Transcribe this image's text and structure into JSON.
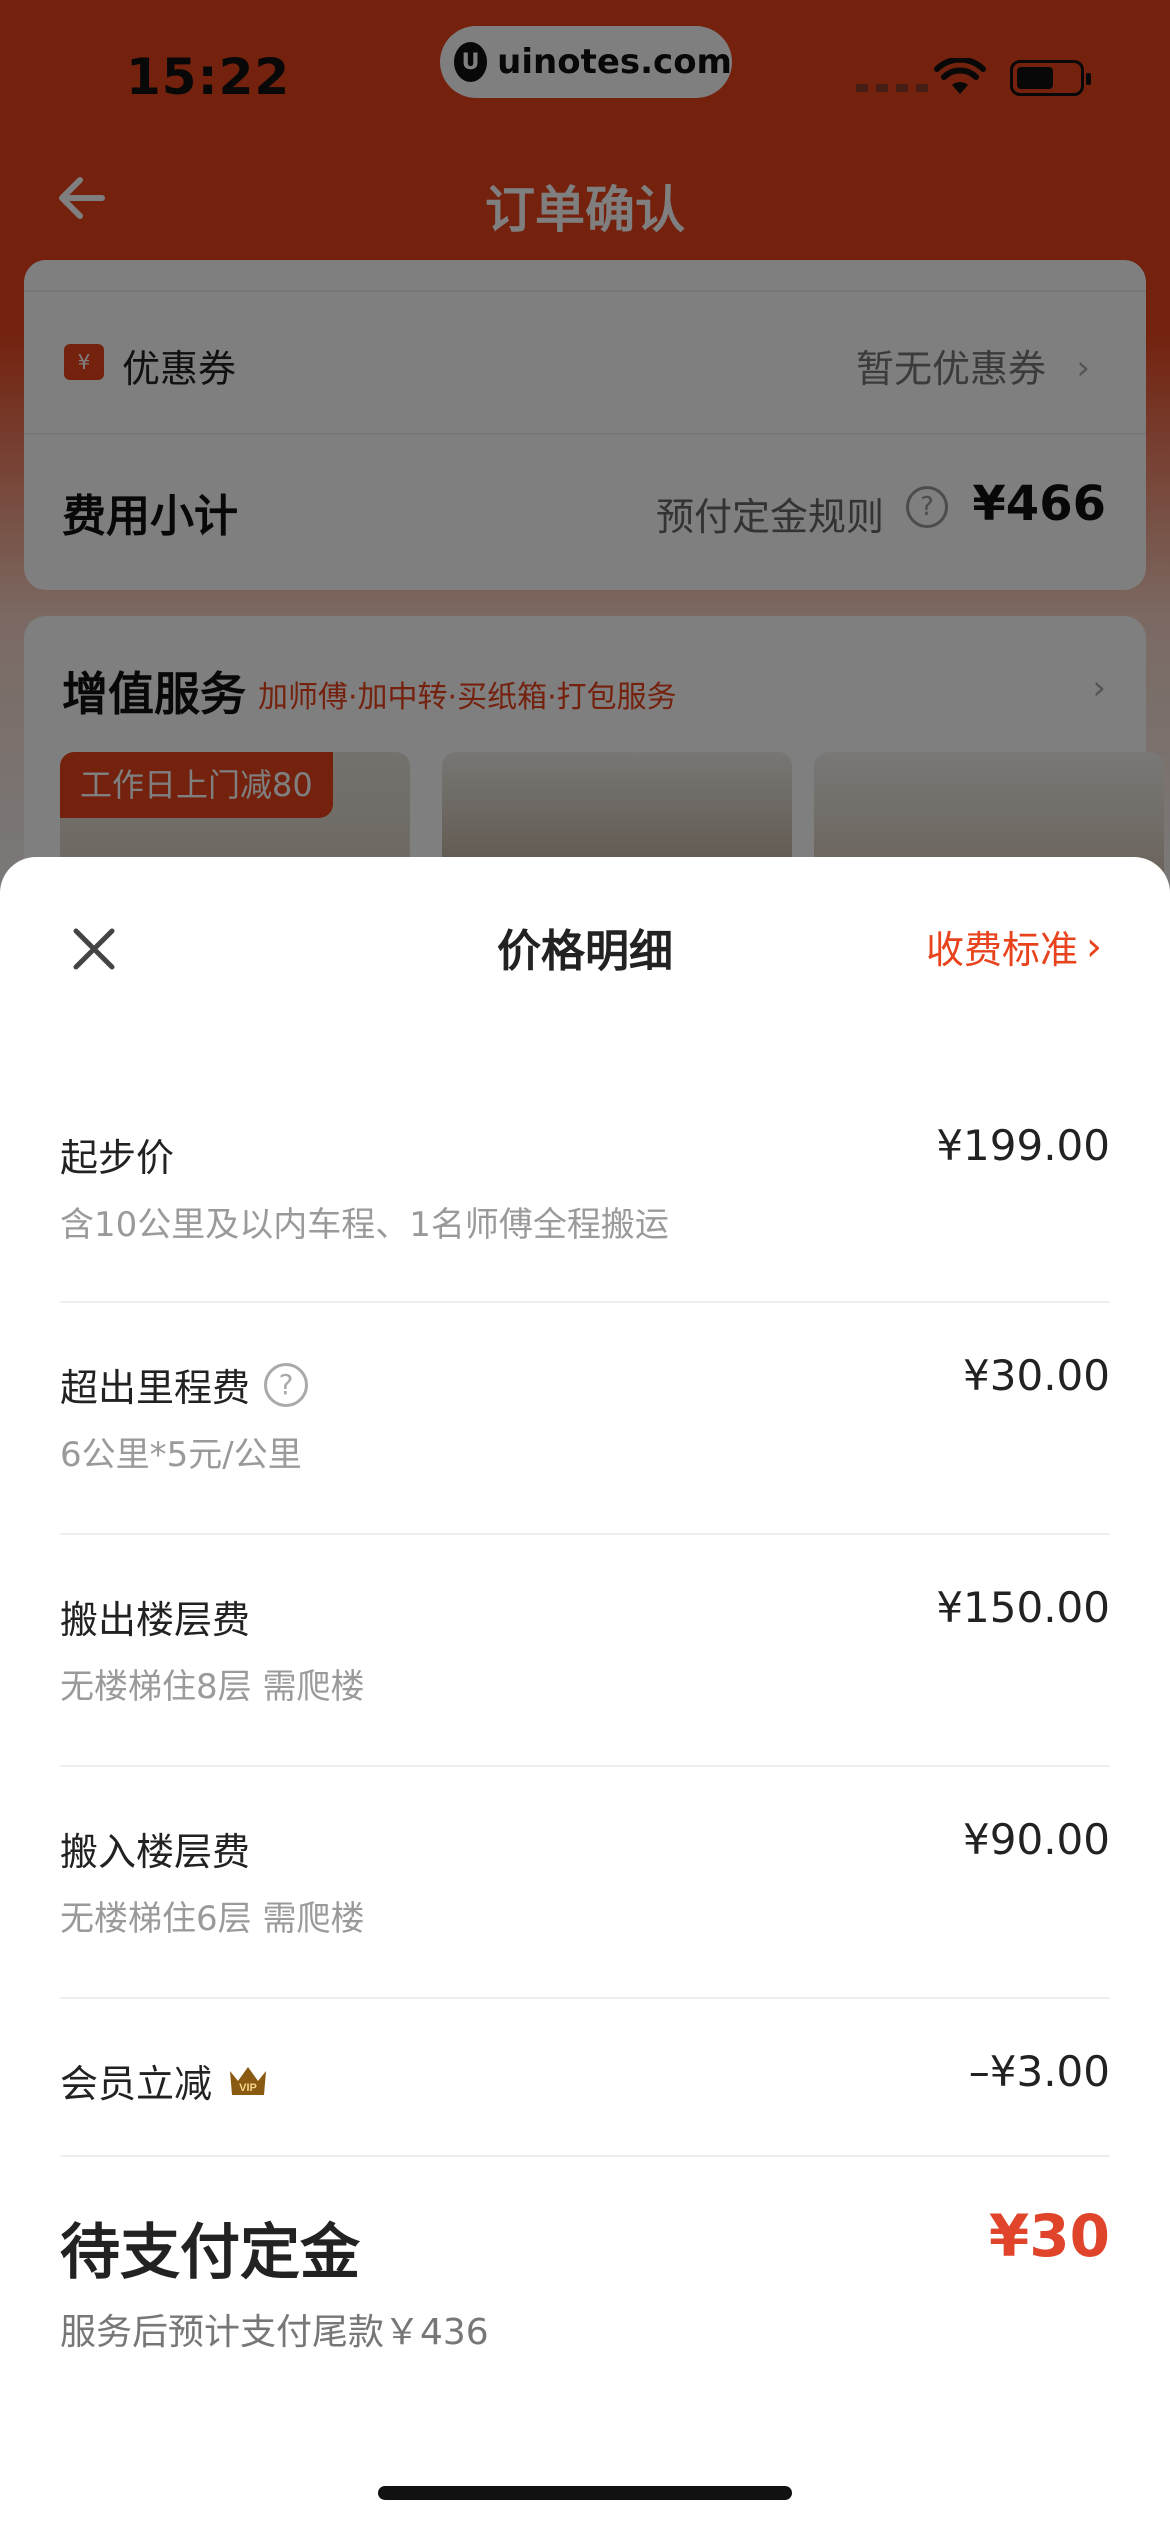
{
  "status_bar": {
    "time": "15:22",
    "watermark": "uinotes.com",
    "watermark_logo": "U"
  },
  "nav": {
    "title": "订单确认",
    "back_icon": "arrow-left-icon"
  },
  "coupon": {
    "label": "优惠券",
    "value": "暂无优惠券",
    "icon_symbol": "¥"
  },
  "subtotal": {
    "label": "费用小计",
    "rule_label": "预付定金规则",
    "amount": "¥466",
    "help_symbol": "?"
  },
  "value_added": {
    "title": "增值服务",
    "subtitle": "加师傅·加中转·买纸箱·打包服务",
    "badge": "工作日上门减80"
  },
  "sheet": {
    "title": "价格明细",
    "link": "收费标准",
    "close_icon": "close-icon"
  },
  "fees": [
    {
      "name": "起步价",
      "desc": "含10公里及以内车程、1名师傅全程搬运",
      "amount": "¥199.00"
    },
    {
      "name": "超出里程费",
      "desc": "6公里*5元/公里",
      "amount": "¥30.00"
    },
    {
      "name": "搬出楼层费",
      "desc": "无楼梯住8层 需爬楼",
      "amount": "¥150.00"
    },
    {
      "name": "搬入楼层费",
      "desc": "无楼梯住6层 需爬楼",
      "amount": "¥90.00"
    },
    {
      "name": "会员立减",
      "desc": "",
      "amount": "–¥3.00"
    }
  ],
  "deposit": {
    "label": "待支付定金",
    "amount": "¥30",
    "note": "服务后预计支付尾款￥436"
  },
  "colors": {
    "accent": "#e8431c",
    "price_accent": "#e0442a"
  }
}
